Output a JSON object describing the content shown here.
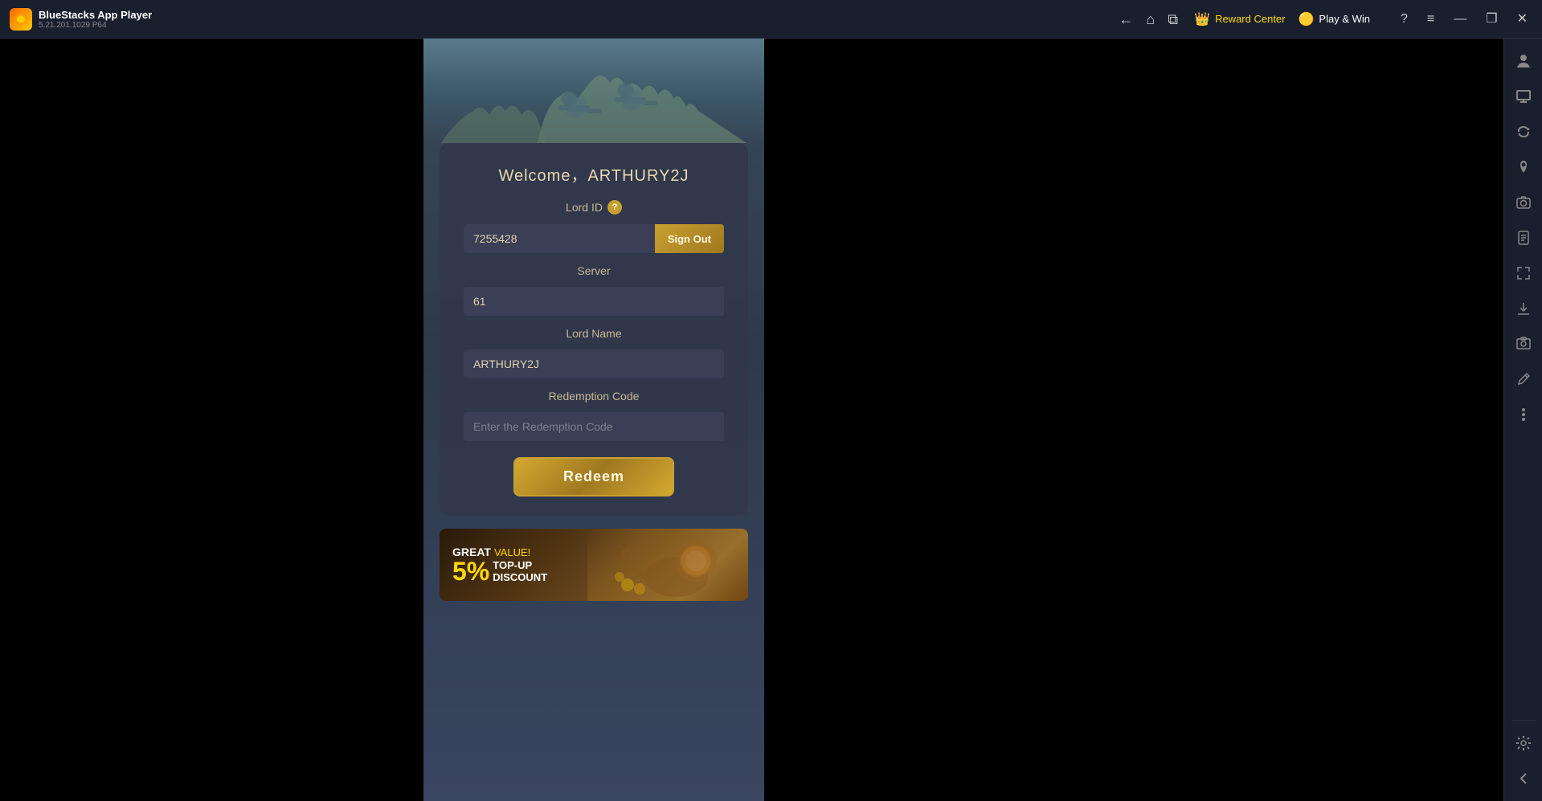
{
  "titlebar": {
    "logo_text": "B",
    "app_name": "BlueStacks App Player",
    "app_version": "5.21.201.1029  P64",
    "nav": {
      "back": "←",
      "home": "⌂",
      "layers": "⧉"
    },
    "reward_center_label": "Reward Center",
    "play_win_label": "Play & Win",
    "help_label": "?",
    "menu_label": "≡",
    "minimize_label": "—",
    "maximize_label": "❐",
    "close_label": "✕"
  },
  "form": {
    "welcome_text": "Welcome，ARTHURY2J",
    "lord_id_label": "Lord ID",
    "lord_id_value": "7255428",
    "sign_out_label": "Sign Out",
    "server_label": "Server",
    "server_value": "61",
    "lord_name_label": "Lord Name",
    "lord_name_value": "ARTHURY2J",
    "redemption_code_label": "Redemption Code",
    "redemption_code_placeholder": "Enter the Redemption Code",
    "redeem_label": "Redeem"
  },
  "banner": {
    "great_value": "GREAT",
    "valve_label": "VALUE!",
    "percent": "5%",
    "topup_label": "TOP-UP",
    "discount_label": "DISCOUNT"
  },
  "sidebar": {
    "icons": [
      {
        "name": "person-icon",
        "symbol": "👤"
      },
      {
        "name": "screen-icon",
        "symbol": "🖥"
      },
      {
        "name": "rotate-icon",
        "symbol": "↻"
      },
      {
        "name": "location-icon",
        "symbol": "📍"
      },
      {
        "name": "camera-icon",
        "symbol": "📷"
      },
      {
        "name": "apk-icon",
        "symbol": "📦"
      },
      {
        "name": "resize-icon",
        "symbol": "⤢"
      },
      {
        "name": "download-icon",
        "symbol": "⬇"
      },
      {
        "name": "screenshot-icon",
        "symbol": "📸"
      },
      {
        "name": "edit-icon",
        "symbol": "✏"
      },
      {
        "name": "more-icon",
        "symbol": "•••"
      },
      {
        "name": "settings-icon",
        "symbol": "⚙"
      },
      {
        "name": "back-icon",
        "symbol": "←"
      }
    ]
  }
}
